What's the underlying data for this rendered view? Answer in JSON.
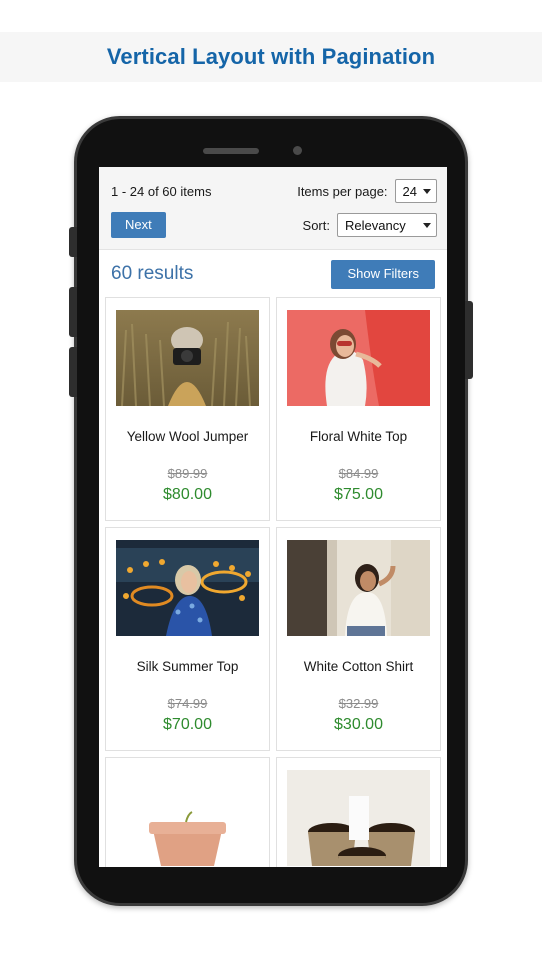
{
  "page": {
    "title": "Vertical Layout with Pagination",
    "background": "#ffffff",
    "band_background": "#f6f6f6",
    "title_color": "#1565a8"
  },
  "colors": {
    "accent_blue": "#3f7cb8",
    "link_blue": "#3d72a8",
    "price_green": "#2e8b2e",
    "price_old_gray": "#8c8c8c",
    "toolbar_background": "#f5f5f5",
    "card_border": "#e0e0e0",
    "phone_frame": "#111111"
  },
  "toolbar": {
    "item_range": "1 - 24 of 60 items",
    "next_label": "Next",
    "items_per_page_label": "Items per page:",
    "items_per_page_value": "24",
    "sort_label": "Sort:",
    "sort_value": "Relevancy"
  },
  "results": {
    "count_text": "60 results",
    "show_filters_label": "Show Filters"
  },
  "products": [
    {
      "title": "Yellow Wool Jumper",
      "price_old": "$89.99",
      "price_new": "$80.00",
      "image": "woman-with-camera-in-cornfield"
    },
    {
      "title": "Floral White Top",
      "price_old": "$84.99",
      "price_new": "$75.00",
      "image": "woman-in-sunglasses-on-red-background"
    },
    {
      "title": "Silk Summer Top",
      "price_old": "$74.99",
      "price_new": "$70.00",
      "image": "woman-in-blue-dress-at-carnival"
    },
    {
      "title": "White Cotton Shirt",
      "price_old": "$32.99",
      "price_new": "$30.00",
      "image": "woman-in-white-shirt-by-building"
    },
    {
      "title": "",
      "price_old": "",
      "price_new": "",
      "image": "terracotta-plant-pot-with-seedling"
    },
    {
      "title": "",
      "price_old": "",
      "price_new": "",
      "image": "three-peat-pots-with-seeds"
    }
  ]
}
